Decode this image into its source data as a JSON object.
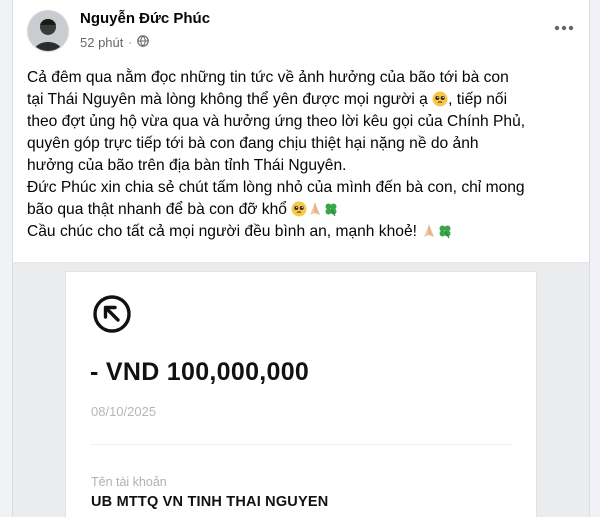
{
  "post": {
    "author": "Nguyễn Đức Phúc",
    "time": "52 phút",
    "dot": "·",
    "privacy_icon": "globe-icon",
    "more_icon": "more-horizontal-icon",
    "lines": [
      {
        "text": "Cả đêm qua nằm đọc những tin tức về ảnh hưởng của bão tới bà con",
        "emoji": []
      },
      {
        "text": "tại Thái Nguyên mà lòng không thể yên được mọi người ạ ",
        "emoji": [
          "pleading-face"
        ],
        "after": ", tiếp nối"
      },
      {
        "text": "theo đợt ủng hộ vừa qua và hưởng ứng theo lời kêu gọi của Chính Phủ,",
        "emoji": []
      },
      {
        "text": "quyên góp trực tiếp tới bà con đang chịu thiệt hại nặng nề do ảnh",
        "emoji": []
      },
      {
        "text": "hưởng của bão trên địa bàn tỉnh Thái Nguyên.",
        "emoji": []
      },
      {
        "text": "Đức Phúc xin chia sẻ chút tấm lòng nhỏ của mình đến bà con, chỉ mong",
        "emoji": []
      },
      {
        "text": "bão qua thật nhanh để bà con đỡ khổ ",
        "emoji": [
          "pleading-face",
          "folded-hands",
          "four-leaf-clover"
        ]
      },
      {
        "text": "Cầu chúc cho tất cả mọi người đều bình an, mạnh khoẻ! ",
        "emoji": [
          "folded-hands",
          "four-leaf-clover"
        ]
      }
    ]
  },
  "receipt": {
    "icon": "arrow-up-left-circle-icon",
    "amount": "- VND 100,000,000",
    "date": "08/10/2025",
    "account_label": "Tên tài khoản",
    "account_name": "UB MTTQ VN TINH THAI NGUYEN"
  },
  "colors": {
    "text_primary": "#050505",
    "text_secondary": "#65676b",
    "page_bg": "#f0f2f5",
    "clover": "#3aa64c",
    "pleading": "#f7c948"
  }
}
